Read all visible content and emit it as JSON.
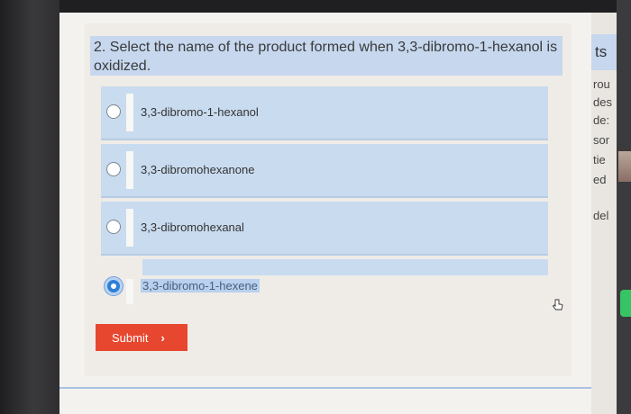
{
  "question": {
    "text": "2. Select the name of the product formed when 3,3-dibromo-1-hexanol is oxidized."
  },
  "options": [
    {
      "label": "3,3-dibromo-1-hexanol",
      "selected": false
    },
    {
      "label": "3,3-dibromohexanone",
      "selected": false
    },
    {
      "label": "3,3-dibromohexanal",
      "selected": false
    },
    {
      "label": "3,3-dibromo-1-hexene",
      "selected": true
    }
  ],
  "submit": {
    "label": "Submit",
    "chevron": "›",
    "color": "#e8472f"
  },
  "side_panel": {
    "header": "ts",
    "fragments": [
      "rou",
      "des",
      "de:",
      "sor",
      "tie",
      "ed",
      "del"
    ]
  },
  "colors": {
    "option_bg": "#c9dbef",
    "selected_radio": "#2f7fd8"
  }
}
